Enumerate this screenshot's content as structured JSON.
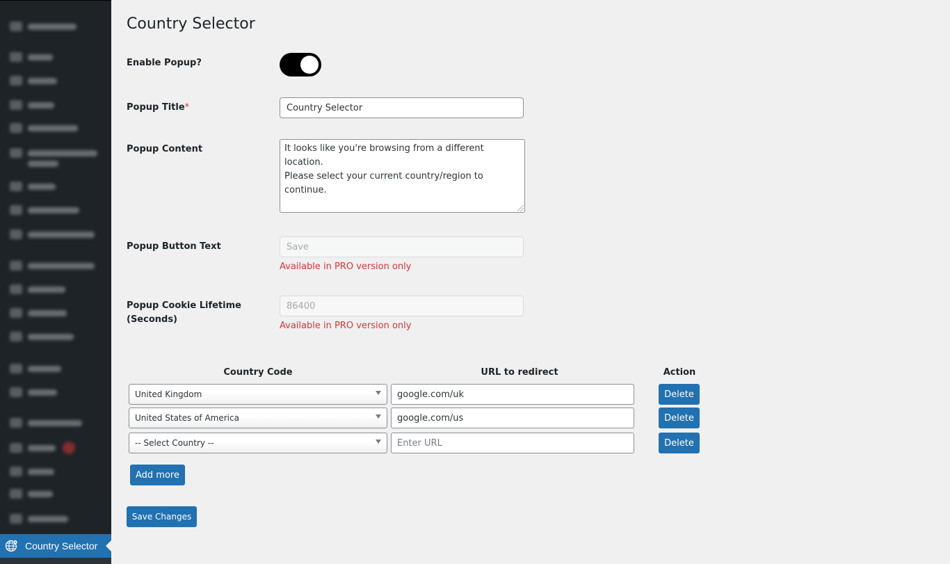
{
  "sidebar": {
    "current_item": "Country Selector"
  },
  "page": {
    "title": "Country Selector"
  },
  "form": {
    "enable_popup": {
      "label": "Enable Popup?",
      "enabled": true
    },
    "popup_title": {
      "label": "Popup Title",
      "required_mark": "*",
      "value": "Country Selector"
    },
    "popup_content": {
      "label": "Popup Content",
      "line1": "It looks like you're browsing from a different location.",
      "line2": "Please select your current country/region to continue."
    },
    "popup_button_text": {
      "label": "Popup Button Text",
      "placeholder": "Save",
      "note": "Available in PRO version only"
    },
    "popup_cookie_lifetime": {
      "label_line1": "Popup Cookie Lifetime",
      "label_line2": "(Seconds)",
      "placeholder": "86400",
      "note": "Available in PRO version only"
    }
  },
  "table": {
    "headers": {
      "country_code": "Country Code",
      "url": "URL to redirect",
      "action": "Action"
    },
    "rows": [
      {
        "country": "United Kingdom",
        "url": "google.com/uk",
        "delete_label": "Delete"
      },
      {
        "country": "United States of America",
        "url": "google.com/us",
        "delete_label": "Delete"
      },
      {
        "country": "-- Select Country --",
        "url_placeholder": "Enter URL",
        "delete_label": "Delete"
      }
    ],
    "add_more_label": "Add more"
  },
  "save_label": "Save Changes",
  "colors": {
    "sidebar_bg": "#1d2327",
    "accent": "#2271b1",
    "error": "#d63638",
    "page_bg": "#f0f0f1"
  }
}
